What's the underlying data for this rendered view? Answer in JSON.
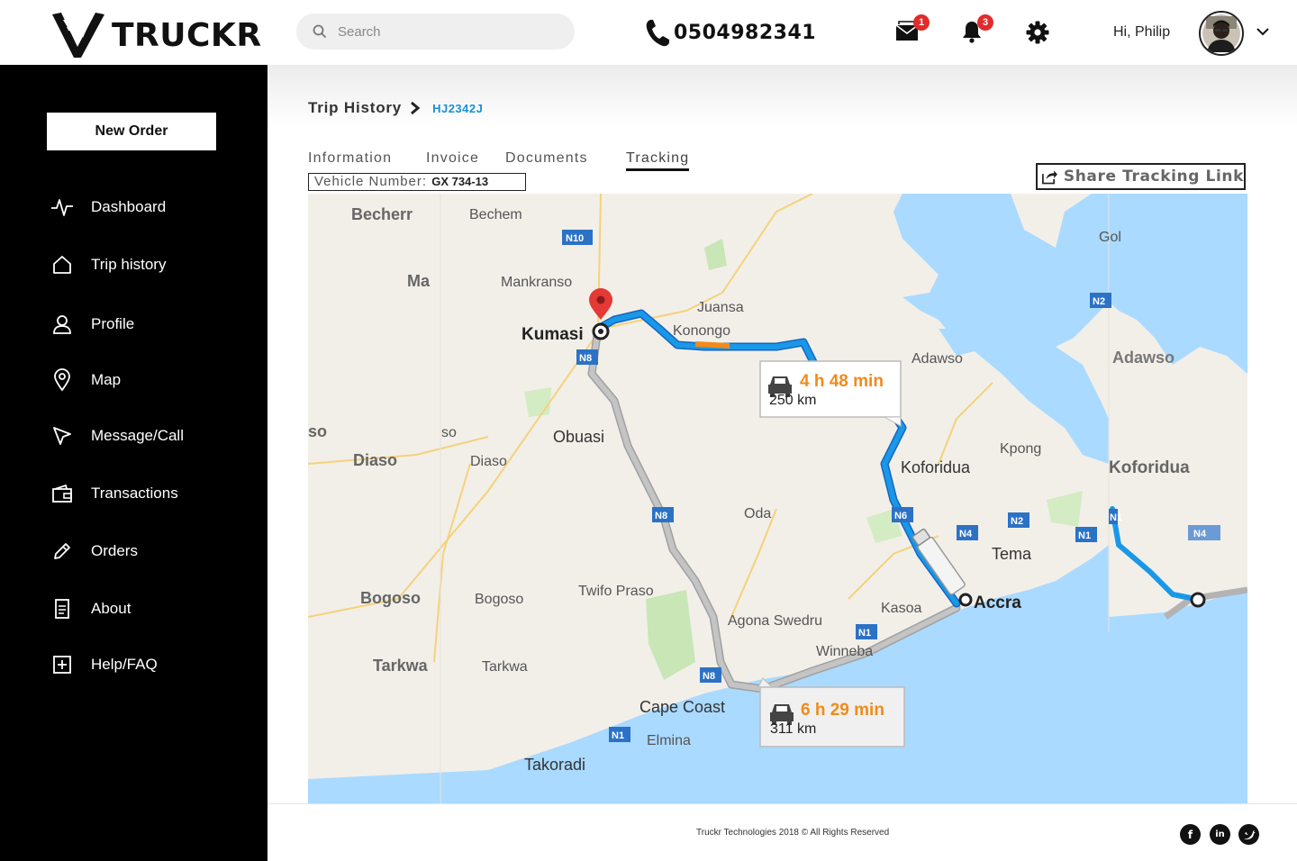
{
  "brand": {
    "name": "TRUCKR"
  },
  "header": {
    "search_placeholder": "Search",
    "phone": "0504982341",
    "messages_count": "1",
    "notifications_count": "3",
    "greeting": "Hi, Philip"
  },
  "sidebar": {
    "new_order": "New Order",
    "items": [
      {
        "label": "Dashboard",
        "icon": "pulse-icon"
      },
      {
        "label": "Trip history",
        "icon": "home-icon"
      },
      {
        "label": "Profile",
        "icon": "user-icon"
      },
      {
        "label": "Map",
        "icon": "map-pin-icon"
      },
      {
        "label": "Message/Call",
        "icon": "send-icon"
      },
      {
        "label": "Transactions",
        "icon": "wallet-icon"
      },
      {
        "label": "Orders",
        "icon": "pencil-icon"
      },
      {
        "label": "About",
        "icon": "document-icon"
      },
      {
        "label": "Help/FAQ",
        "icon": "plus-square-icon"
      }
    ]
  },
  "breadcrumb": {
    "root": "Trip History",
    "current": "HJ2342J"
  },
  "tabs": [
    "Information",
    "Invoice",
    "Documents",
    "Tracking"
  ],
  "active_tab": "Tracking",
  "vehicle": {
    "label": "Vehicle Number:",
    "number": "GX 734-13"
  },
  "share_button": "Share Tracking Link",
  "map": {
    "routes": [
      {
        "duration": "4 h 48 min",
        "distance": "250 km"
      },
      {
        "duration": "6 h 29 min",
        "distance": "311 km"
      }
    ],
    "places": [
      "Becherr",
      "Bechem",
      "Mankranso",
      "Juansa",
      "Konongo",
      "Kumasi",
      "Ma",
      "Adawso",
      "Adawso",
      "Obuasi",
      "Diaso",
      "Diaso",
      "Kpong",
      "Koforidua",
      "Koforidua",
      "Oda",
      "Tema",
      "Twifo Praso",
      "Kasoa",
      "Accra",
      "Bogoso",
      "Bogoso",
      "Agona Swedru",
      "Winneba",
      "Tarkwa",
      "Tarkwa",
      "Cape Coast",
      "Elmina",
      "Takoradi",
      "Gol",
      "so",
      "so"
    ],
    "road_labels": [
      "N10",
      "N8",
      "N8",
      "N8",
      "N6",
      "N4",
      "N4",
      "N2",
      "N2",
      "N1",
      "N1",
      "N1",
      "N1"
    ]
  },
  "footer": {
    "copyright": "Truckr Technologies 2018 © All Rights Reserved"
  },
  "colors": {
    "accent_blue": "#1a8fd8",
    "route_blue": "#1a98e8",
    "route_gray": "#b7b7b7",
    "duration_orange": "#f08b1b",
    "water": "#aadaff",
    "badge_red": "#e12b2b"
  }
}
